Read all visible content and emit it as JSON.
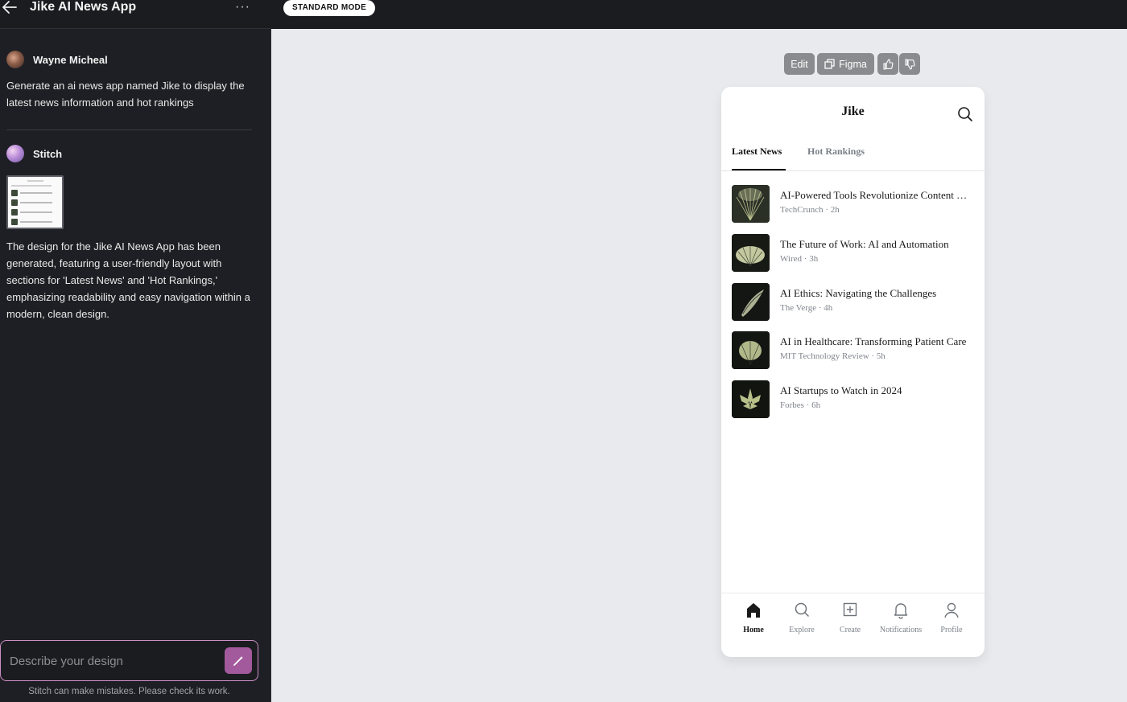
{
  "header": {
    "title": "Jike AI News App",
    "mode_label": "STANDARD MODE"
  },
  "chat": {
    "user": {
      "name": "Wayne Micheal",
      "message": "Generate an ai news app named Jike to display the latest news information and hot rankings"
    },
    "assistant": {
      "name": "Stitch",
      "message": "The design for the Jike AI News App has been generated, featuring a user-friendly layout with sections for 'Latest News' and 'Hot Rankings,' emphasizing readability and easy navigation within a modern, clean design."
    },
    "input_placeholder": "Describe your design",
    "disclaimer": "Stitch can make mistakes. Please check its work."
  },
  "toolbar": {
    "edit_label": "Edit",
    "figma_label": "Figma"
  },
  "preview": {
    "app_title": "Jike",
    "tabs": [
      {
        "label": "Latest News",
        "active": true
      },
      {
        "label": "Hot Rankings",
        "active": false
      }
    ],
    "news": [
      {
        "title": "AI-Powered Tools Revolutionize Content Creation",
        "meta": "TechCrunch · 2h"
      },
      {
        "title": "The Future of Work: AI and Automation",
        "meta": "Wired · 3h"
      },
      {
        "title": "AI Ethics: Navigating the Challenges",
        "meta": "The Verge · 4h"
      },
      {
        "title": "AI in Healthcare: Transforming Patient Care",
        "meta": "MIT Technology Review · 5h"
      },
      {
        "title": "AI Startups to Watch in 2024",
        "meta": "Forbes · 6h"
      }
    ],
    "nav": [
      {
        "label": "Home",
        "icon": "home-icon",
        "active": true
      },
      {
        "label": "Explore",
        "icon": "search-icon",
        "active": false
      },
      {
        "label": "Create",
        "icon": "plus-square-icon",
        "active": false
      },
      {
        "label": "Notifications",
        "icon": "bell-icon",
        "active": false
      },
      {
        "label": "Profile",
        "icon": "user-icon",
        "active": false
      }
    ]
  },
  "colors": {
    "accent": "#a35a9c",
    "input_border": "#cc8fc6",
    "sidebar_bg": "#1e1f24",
    "canvas_bg": "#e8eaed"
  }
}
